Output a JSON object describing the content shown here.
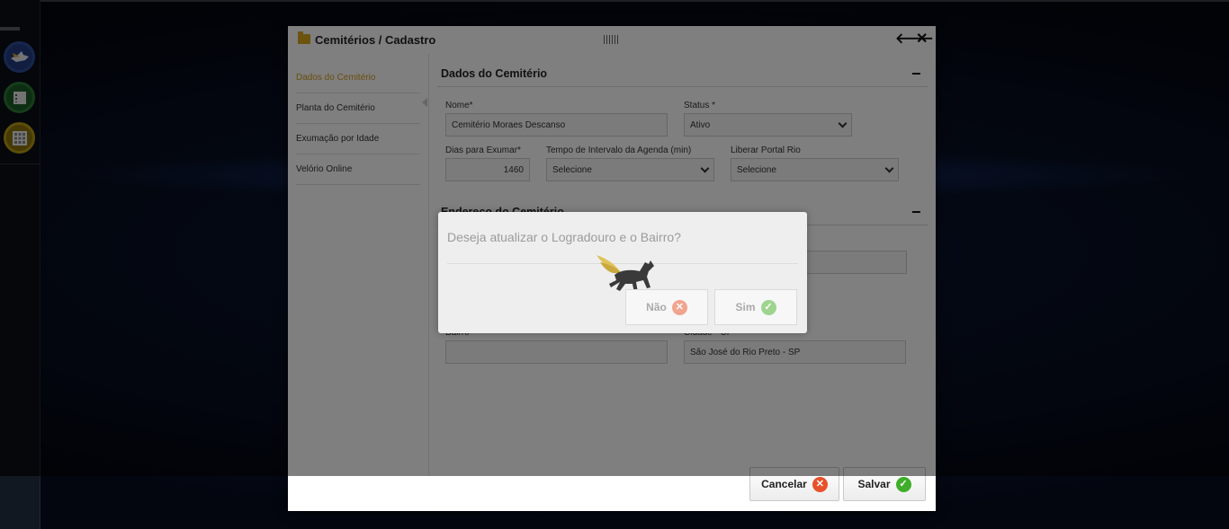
{
  "window": {
    "title": "Cemitérios / Cadastro"
  },
  "sidenav": {
    "items": [
      {
        "label": "Dados do Cemitério"
      },
      {
        "label": "Planta do Cemitério"
      },
      {
        "label": "Exumação por Idade"
      },
      {
        "label": "Velório Online"
      }
    ],
    "active_color": "#d49a1a"
  },
  "section1": {
    "title": "Dados do Cemitério",
    "nome": {
      "label": "Nome*",
      "value": "Cemitério Moraes Descanso"
    },
    "status": {
      "label": "Status *",
      "value": "Ativo"
    },
    "dias": {
      "label": "Dias para Exumar*",
      "value": "1460"
    },
    "tempo": {
      "label": "Tempo de Intervalo da Agenda (min)",
      "value": "Selecione"
    },
    "portal": {
      "label": "Liberar Portal Rio",
      "value": "Selecione"
    }
  },
  "section2": {
    "title": "Endereço do Cemitério",
    "bairro": {
      "label": "Bairro",
      "value": ""
    },
    "cidade": {
      "label": "Cidade - UF",
      "value": "São José do Rio Preto - SP"
    }
  },
  "footer": {
    "cancel_label": "Cancelar",
    "save_label": "Salvar"
  },
  "dialog": {
    "message": "Deseja atualizar o Logradouro e o Bairro?",
    "no_label": "Não",
    "yes_label": "Sim"
  },
  "icons": {
    "folder": "folder-icon",
    "back": "arrow-left-icon",
    "close": "close-icon",
    "collapse": "minus-icon",
    "cancel": "x-circle-icon",
    "save": "check-circle-icon"
  }
}
